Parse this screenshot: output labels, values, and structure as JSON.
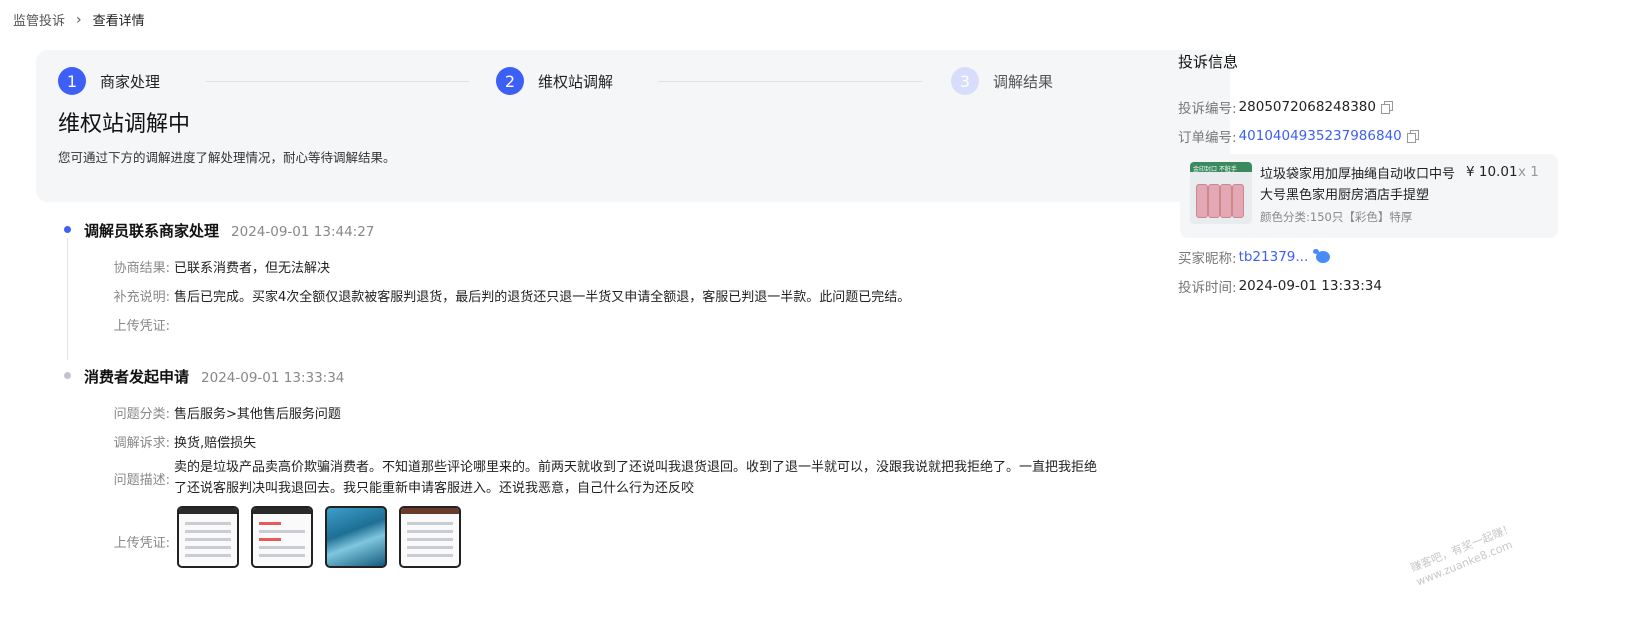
{
  "breadcrumb": {
    "parent": "监管投诉",
    "separator": "›",
    "current": "查看详情"
  },
  "steps": [
    {
      "number": "1",
      "label": "商家处理",
      "state": "done"
    },
    {
      "number": "2",
      "label": "维权站调解",
      "state": "active"
    },
    {
      "number": "3",
      "label": "调解结果",
      "state": "pending"
    }
  ],
  "status": {
    "title": "维权站调解中",
    "description": "您可通过下方的调解进度了解处理情况，耐心等待调解结果。"
  },
  "timeline": [
    {
      "title": "调解员联系商家处理",
      "time": "2024-09-01 13:44:27",
      "fields": [
        {
          "key": "协商结果:",
          "value": "已联系消费者，但无法解决"
        },
        {
          "key": "补充说明:",
          "value": "售后已完成。买家4次全额仅退款被客服判退货，最后判的退货还只退一半货又申请全额退，客服已判退一半款。此问题已完结。"
        },
        {
          "key": "上传凭证:",
          "value": ""
        }
      ]
    },
    {
      "title": "消费者发起申请",
      "time": "2024-09-01 13:33:34",
      "fields": [
        {
          "key": "问题分类:",
          "value": "售后服务>其他售后服务问题"
        },
        {
          "key": "调解诉求:",
          "value": "换货,赔偿损失"
        },
        {
          "key": "问题描述:",
          "value": "卖的是垃圾产品卖高价欺骗消费者。不知道那些评论哪里来的。前两天就收到了还说叫我退货退回。收到了退一半就可以，没跟我说就把我拒绝了。一直把我拒绝了还说客服判决叫我退回去。我只能重新申请客服进入。还说我恶意，自己什么行为还反咬"
        },
        {
          "key": "上传凭证:",
          "value": ""
        }
      ]
    }
  ],
  "side": {
    "title": "投诉信息",
    "complaint_no_key": "投诉编号:",
    "complaint_no": "2805072068248380",
    "order_no_key": "订单编号:",
    "order_no": "4010404935237986840",
    "product": {
      "image_text": "金印封口 不脏手",
      "name": "垃圾袋家用加厚抽绳自动收口中号大号黑色家用厨房酒店手提塑",
      "price": "¥ 10.01",
      "qty": "x 1",
      "attr": "颜色分类:150只【彩色】特厚"
    },
    "buyer_key": "买家昵称:",
    "buyer": "tb21379...",
    "time_key": "投诉时间:",
    "time": "2024-09-01 13:33:34"
  },
  "watermark": [
    "赚客吧，有奖一起赚！",
    "www.zuanke8.com"
  ]
}
